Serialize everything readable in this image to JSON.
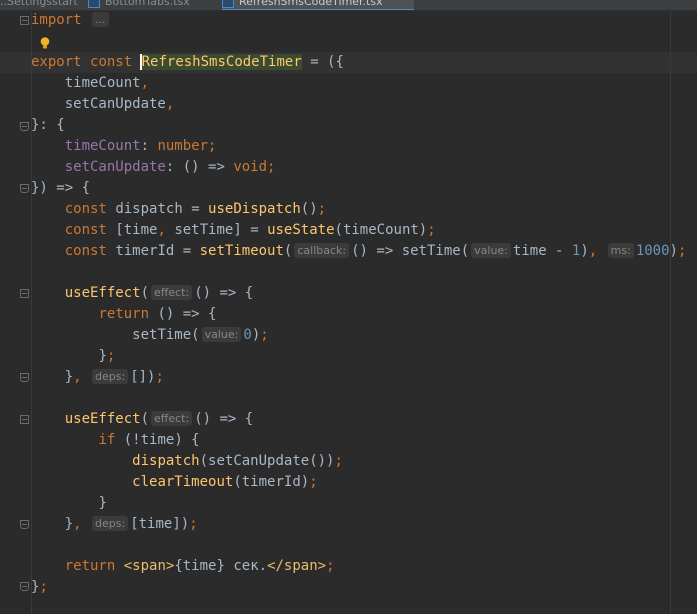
{
  "tabs": [
    {
      "label": "..Settingsstart"
    },
    {
      "label": "BottomTabs.tsx"
    },
    {
      "label": "RefreshSmsCodeTimer.tsx"
    }
  ],
  "code": {
    "import_kw": "import",
    "import_fold": "...",
    "export_kw": "export",
    "const_kw": "const",
    "component_name": "RefreshSmsCodeTimer",
    "p_timeCount": "timeCount",
    "p_setCanUpdate": "setCanUpdate",
    "type_number": "number",
    "type_void": "void",
    "dispatch": "dispatch",
    "useDispatch": "useDispatch",
    "time": "time",
    "setTime": "setTime",
    "useState": "useState",
    "timerId": "timerId",
    "setTimeout": "setTimeout",
    "hint_callback": "callback:",
    "hint_value": "value:",
    "hint_ms": "ms:",
    "num_1": "1",
    "num_1000": "1000",
    "num_0": "0",
    "useEffect": "useEffect",
    "hint_effect": "effect:",
    "hint_deps": "deps:",
    "return_kw": "return",
    "if_kw": "if",
    "clearTimeout": "clearTimeout",
    "span_open": "<span>",
    "span_close": "</span>",
    "sec_text": " сек."
  }
}
